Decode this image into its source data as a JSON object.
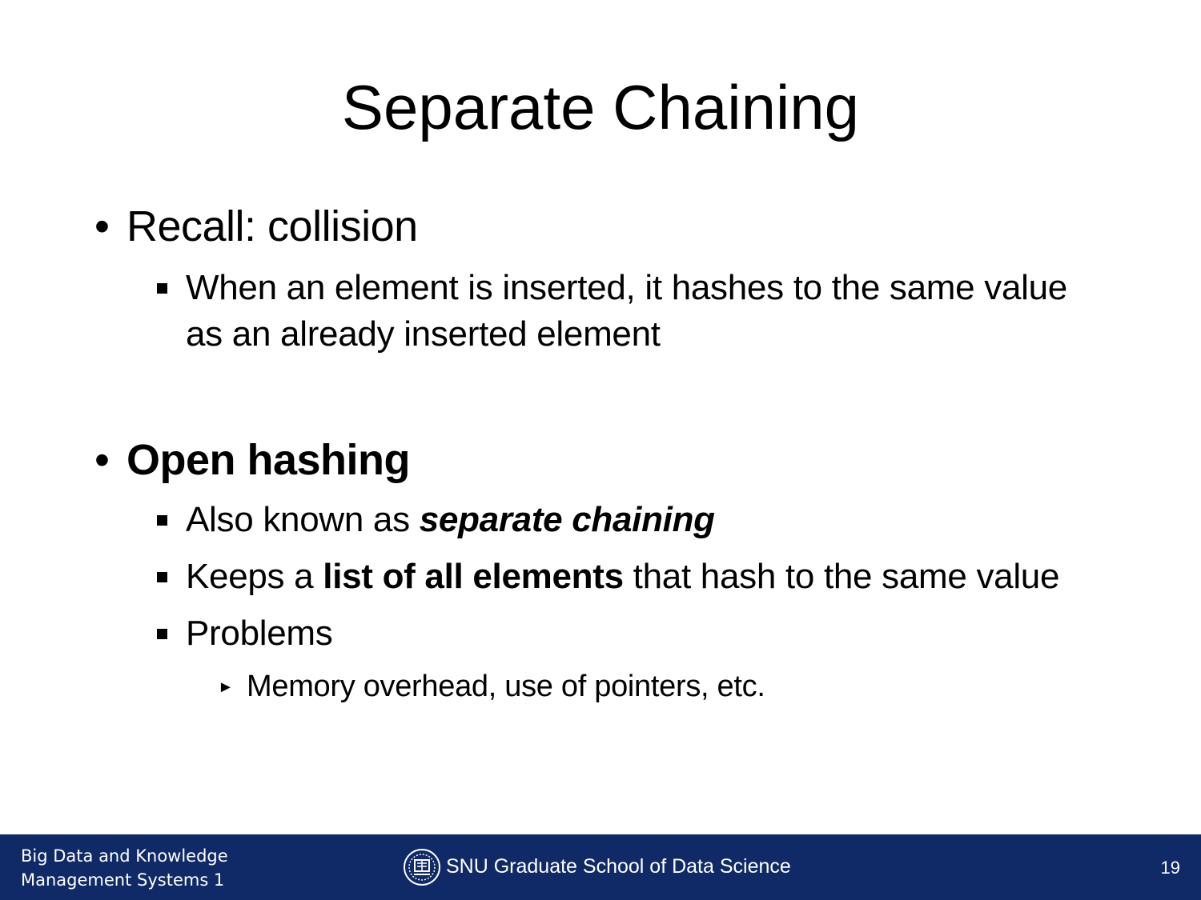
{
  "title": "Separate Chaining",
  "bullets": {
    "recall": {
      "text": "Recall: collision",
      "sub": "When an element is inserted, it hashes to the same value as an already inserted element"
    },
    "open": {
      "text": "Open hashing",
      "aka_prefix": "Also known as ",
      "aka_emph": "separate chaining",
      "keeps_prefix": "Keeps a ",
      "keeps_bold": "list of all elements",
      "keeps_suffix": " that hash to the same value",
      "problems": "Problems",
      "problems_sub": "Memory overhead, use of pointers, etc."
    }
  },
  "footer": {
    "course_line1": "Big Data and Knowledge",
    "course_line2": "Management Systems 1",
    "school": "SNU Graduate School of Data Science",
    "page": "19",
    "bg_color": "#0f2a66"
  }
}
